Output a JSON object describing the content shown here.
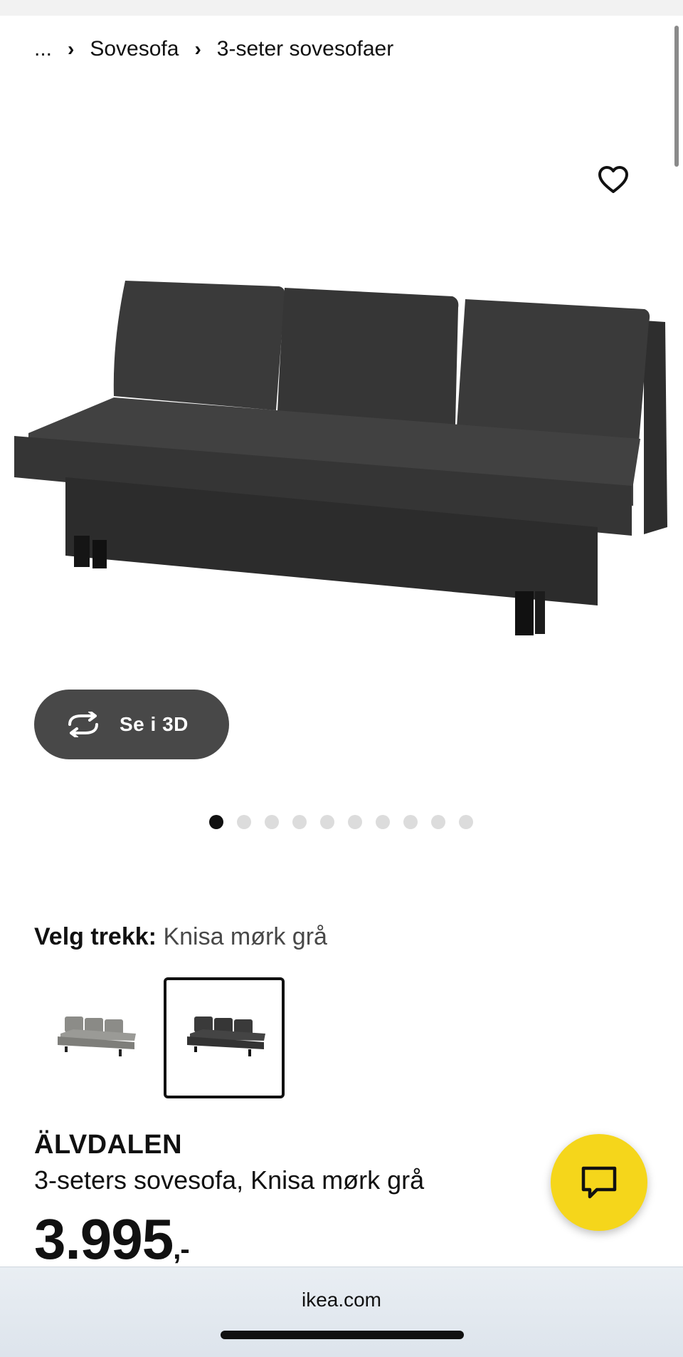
{
  "breadcrumb": {
    "ellipsis": "...",
    "items": [
      "Sovesofa",
      "3-seter sovesofaer"
    ]
  },
  "gallery": {
    "view_3d_label": "Se i 3D",
    "dot_count": 10,
    "active_dot": 0
  },
  "variant": {
    "label": "Velg trekk:",
    "value": "Knisa mørk grå",
    "swatches": [
      "light-grey-sofa",
      "dark-grey-sofa"
    ],
    "selected_index": 1
  },
  "product": {
    "name": "ÄLVDALEN",
    "description": "3-seters sovesofa, Knisa mørk grå",
    "price": "3.995",
    "price_suffix": ",-"
  },
  "browser": {
    "url": "ikea.com"
  },
  "colors": {
    "accent_yellow": "#f5d61b",
    "button_dark": "#484848",
    "sofa_dark": "#3a3a3a",
    "sofa_light": "#8c8c88"
  },
  "icons": {
    "favorite": "heart-icon",
    "view_3d": "rotate-icon",
    "chat": "chat-bubble-icon"
  }
}
